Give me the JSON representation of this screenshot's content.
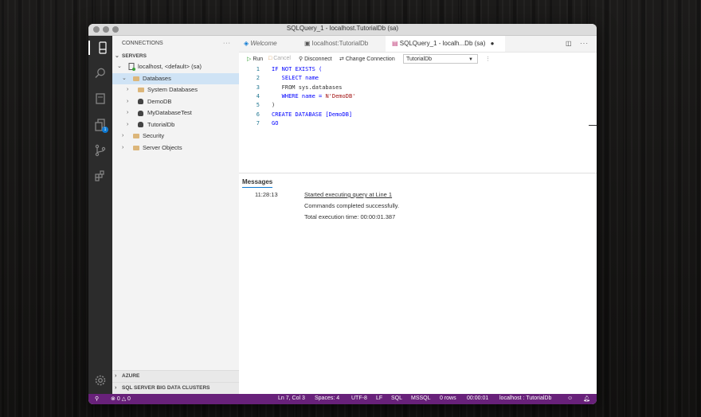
{
  "window": {
    "title": "SQLQuery_1 - localhost.TutorialDb (sa)"
  },
  "activity_bar": {
    "items": [
      {
        "icon": "connections-icon"
      },
      {
        "icon": "search-icon"
      },
      {
        "icon": "notebook-icon"
      },
      {
        "icon": "explorer-icon",
        "badge": "1"
      },
      {
        "icon": "source-control-icon"
      },
      {
        "icon": "extensions-icon"
      }
    ],
    "settings_icon": "gear-icon"
  },
  "sidebar": {
    "title": "CONNECTIONS",
    "more": "···",
    "servers_section": "SERVERS",
    "tree": [
      {
        "label": "localhost, <default> (sa)",
        "type": "server",
        "expanded": true
      },
      {
        "label": "Databases",
        "type": "folder",
        "expanded": true,
        "selected": true
      },
      {
        "label": "System Databases",
        "type": "folder"
      },
      {
        "label": "DemoDB",
        "type": "database"
      },
      {
        "label": "MyDatabaseTest",
        "type": "database"
      },
      {
        "label": "TutorialDb",
        "type": "database"
      },
      {
        "label": "Security",
        "type": "folder"
      },
      {
        "label": "Server Objects",
        "type": "folder"
      }
    ],
    "azure_section": "AZURE",
    "bdc_section": "SQL SERVER BIG DATA CLUSTERS"
  },
  "tabs": [
    {
      "label": "Welcome",
      "active": false
    },
    {
      "label": "localhost:TutorialDb",
      "active": false
    },
    {
      "label": "SQLQuery_1 - localh...Db (sa)",
      "active": true,
      "dirty": "●"
    }
  ],
  "toolbar": {
    "run": "Run",
    "cancel": "Cancel",
    "disconnect": "Disconnect",
    "change_connection": "Change Connection",
    "database": "TutorialDb"
  },
  "code_lines": [
    {
      "n": "1",
      "text": "IF NOT EXISTS ("
    },
    {
      "n": "2",
      "text": "   SELECT name"
    },
    {
      "n": "3",
      "text": "   FROM sys.databases"
    },
    {
      "n": "4",
      "text": "   WHERE name = N'DemoDB'"
    },
    {
      "n": "5",
      "text": ")"
    },
    {
      "n": "6",
      "text": "CREATE DATABASE [DemoDB]"
    },
    {
      "n": "7",
      "text": "GO"
    }
  ],
  "messages": {
    "tab": "Messages",
    "time": "11:28:13",
    "line1": "Started executing query at Line 1",
    "line2": "Commands completed successfully.",
    "line3": "Total execution time: 00:00:01.387"
  },
  "statusbar": {
    "errors": "0",
    "warnings": "0",
    "position": "Ln 7, Col 3",
    "spaces": "Spaces: 4",
    "encoding": "UTF-8",
    "eol": "LF",
    "language": "SQL",
    "provider": "MSSQL",
    "rows": "0 rows",
    "elapsed": "00:00:01",
    "connection": "localhost : TutorialDb"
  },
  "colors": {
    "statusbar": "#68217a",
    "accent": "#0e7ad3",
    "folder": "#dcb67a"
  }
}
